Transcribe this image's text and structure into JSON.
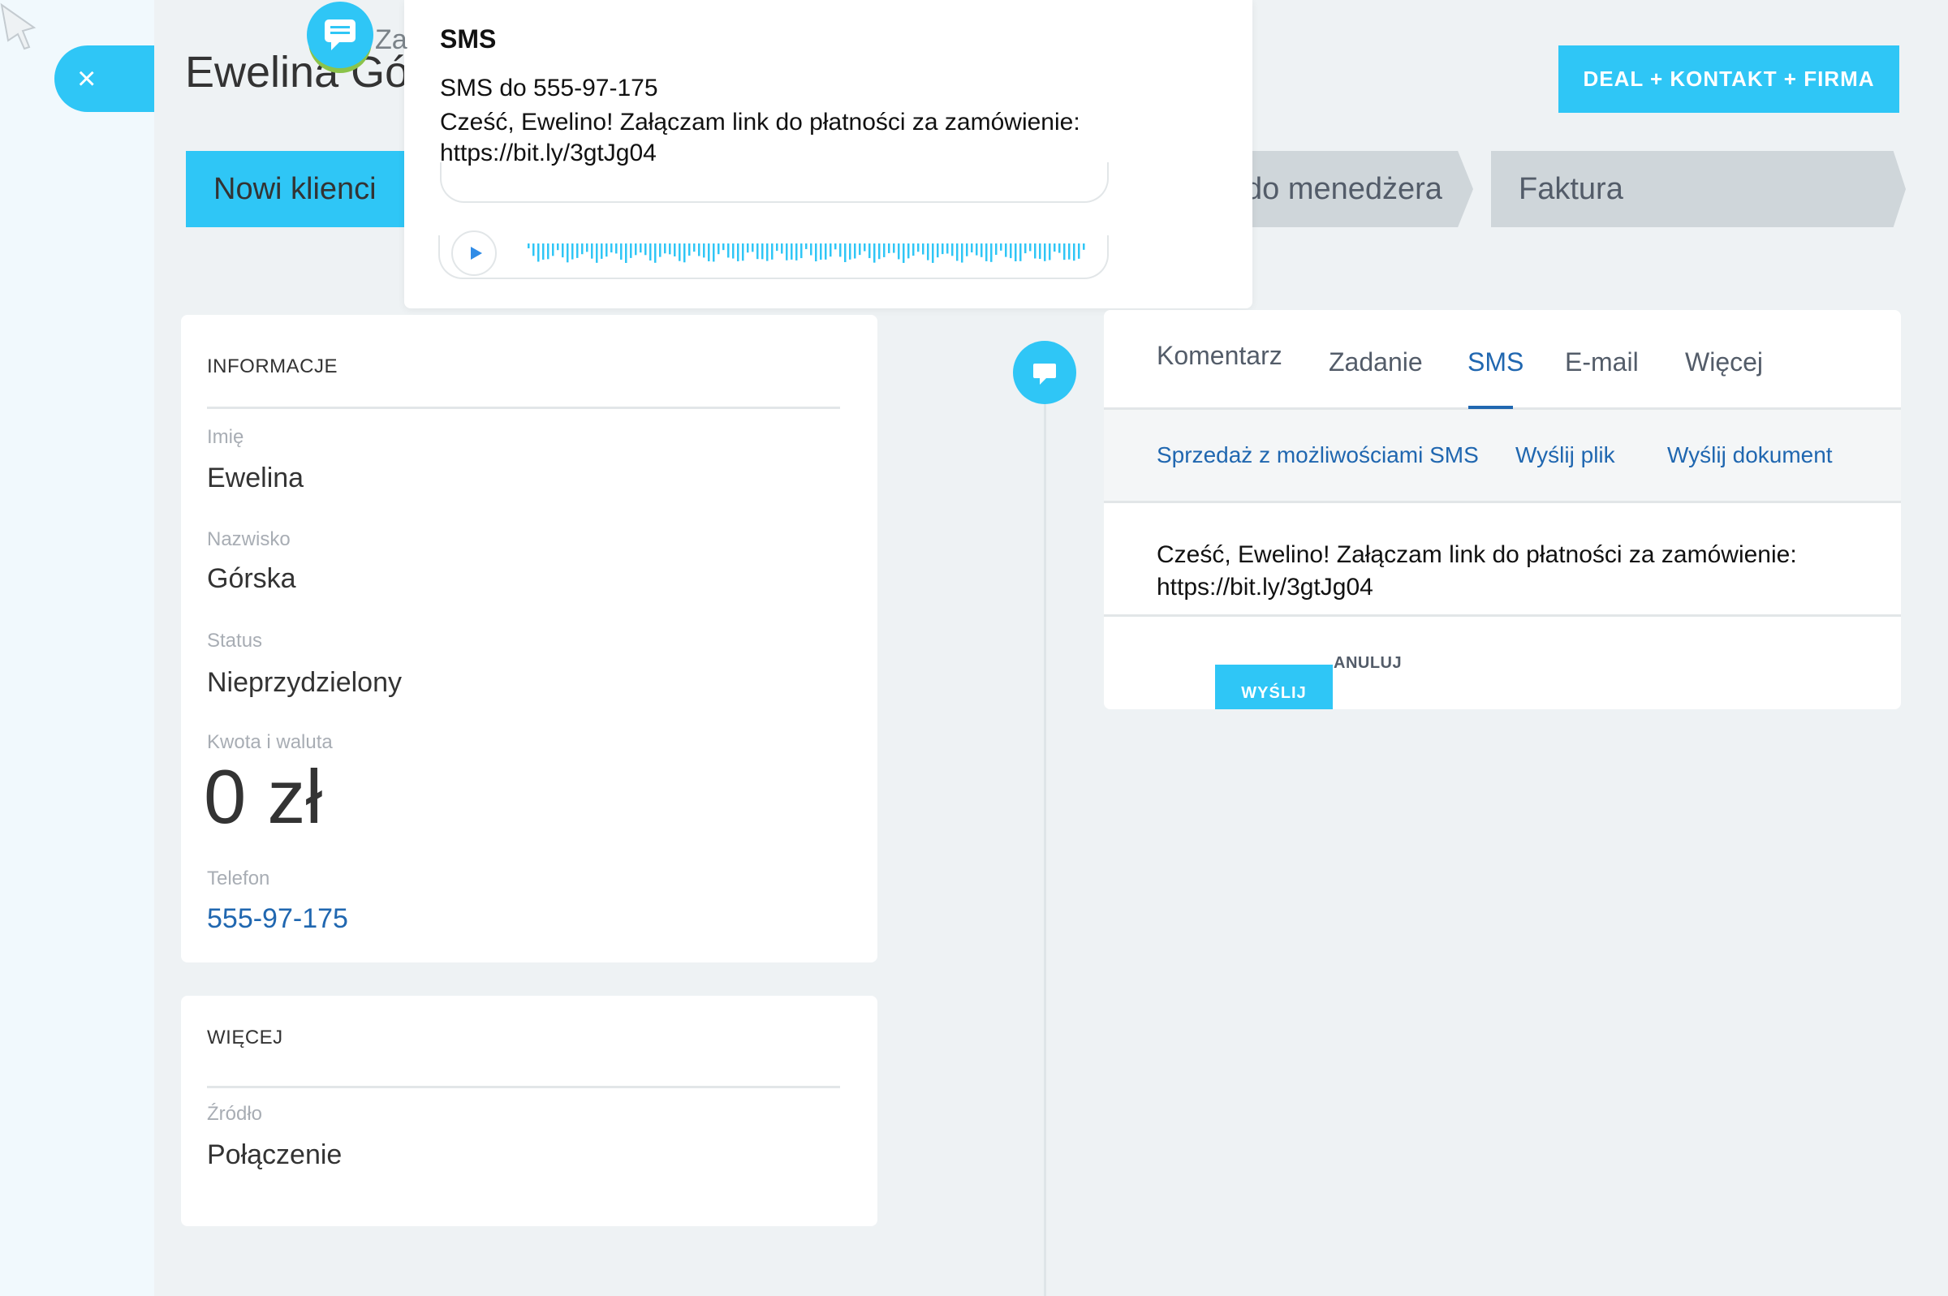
{
  "header": {
    "title": "Ewelina Gó...",
    "title_hint": "Za",
    "close_label": "×",
    "top_action_label": "DEAL + KONTAKT + FIRMA"
  },
  "stages": [
    {
      "label": "Nowi klienci"
    },
    {
      "label": "do menedżera"
    },
    {
      "label": "Faktura"
    }
  ],
  "popup": {
    "title": "SMS",
    "recipient": "SMS do 555-97-175",
    "message": "Cześć, Ewelino! Załączam link do płatności za zamówienie: https://bit.ly/3gtJg04"
  },
  "info_card": {
    "header": "INFORMACJE",
    "fields": [
      {
        "label": "Imię",
        "value": "Ewelina"
      },
      {
        "label": "Nazwisko",
        "value": "Górska"
      },
      {
        "label": "Status",
        "value": "Nieprzydzielony"
      },
      {
        "label": "Kwota i waluta",
        "value": "0 zł"
      },
      {
        "label": "Telefon",
        "value": "555-97-175"
      }
    ]
  },
  "more_card": {
    "header": "WIĘCEJ",
    "fields": [
      {
        "label": "Źródło",
        "value": "Połączenie"
      }
    ]
  },
  "editor": {
    "tabs": [
      "Komentarz",
      "Zadanie",
      "SMS",
      "E-mail",
      "Więcej"
    ],
    "active_tab": "SMS",
    "subtabs": [
      "Sprzedaż z możliwościami SMS",
      "Wyślij plik",
      "Wyślij dokument"
    ],
    "message": "Cześć, Ewelino! Załączam link do płatności za zamówienie: https://bit.ly/3gtJg04",
    "send_label": "WYŚLIJ",
    "cancel_label": "ANULUJ"
  },
  "colors": {
    "accent": "#2fc6f6",
    "link": "#2067b0",
    "stage_inactive": "#cfd6da"
  }
}
